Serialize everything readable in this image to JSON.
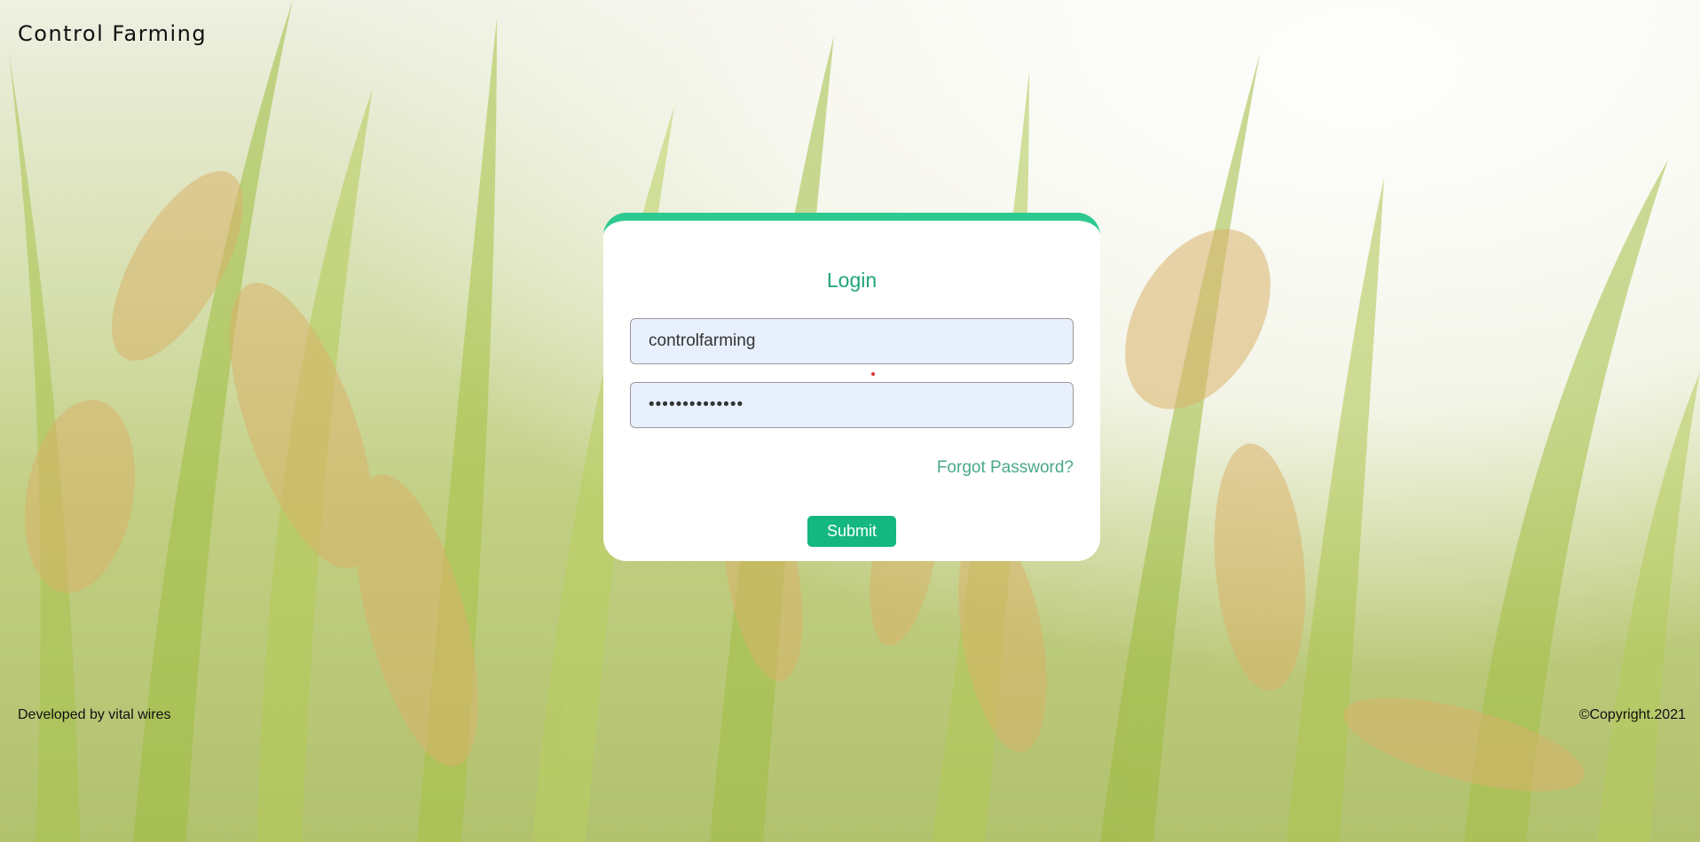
{
  "header": {
    "brand": "Control Farming"
  },
  "login": {
    "title": "Login",
    "username_value": "controlfarming",
    "password_value": "••••••••••••••",
    "forgot_label": "Forgot Password?",
    "submit_label": "Submit"
  },
  "footer": {
    "developer": "Developed by vital wires",
    "copyright": "©Copyright.2021"
  },
  "colors": {
    "accent": "#2ec990",
    "title": "#1fa577",
    "button": "#14b77f",
    "link": "#4aa88a",
    "field_bg": "#e8f0fe"
  },
  "background": {
    "icon": "rice-field-background"
  }
}
